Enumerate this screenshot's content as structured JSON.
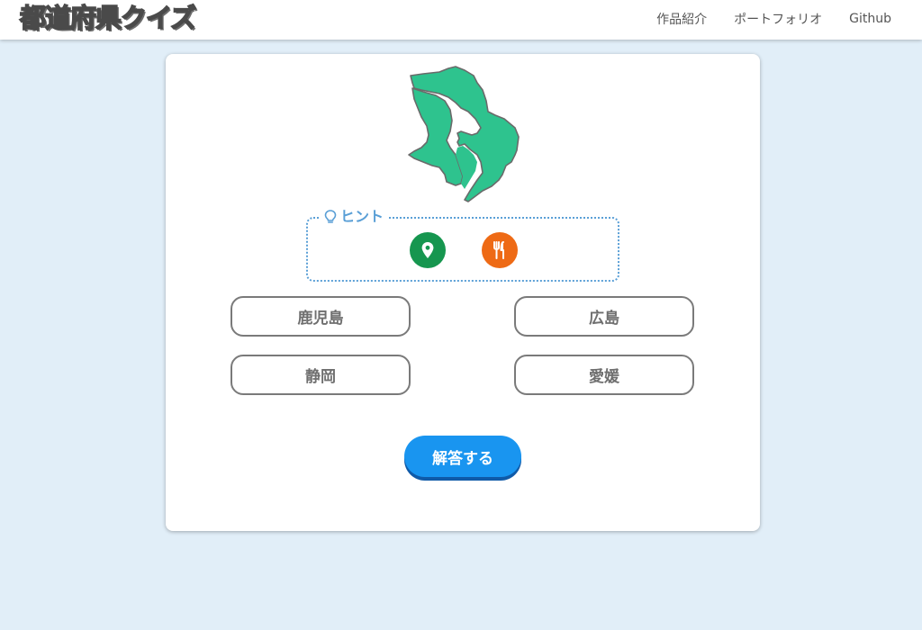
{
  "header": {
    "logo_parts": [
      "都",
      "道",
      "府県クイズ"
    ],
    "nav": [
      "作品紹介",
      "ポートフォリオ",
      "Github"
    ]
  },
  "quiz": {
    "map_icon": "prefecture-silhouette",
    "map_color": "#2ec38e",
    "hint": {
      "label": "ヒント",
      "icons": [
        "lightbulb-icon",
        "location-pin-icon",
        "fork-knife-icon"
      ]
    },
    "choices": [
      "鹿児島",
      "広島",
      "静岡",
      "愛媛"
    ],
    "answer_label": "解答する"
  },
  "colors": {
    "background": "#e1eef8",
    "accent": "#1995f0",
    "hint_blue": "#5a9fd6",
    "map_hint": "#16964f",
    "food_hint": "#ee6a15"
  }
}
